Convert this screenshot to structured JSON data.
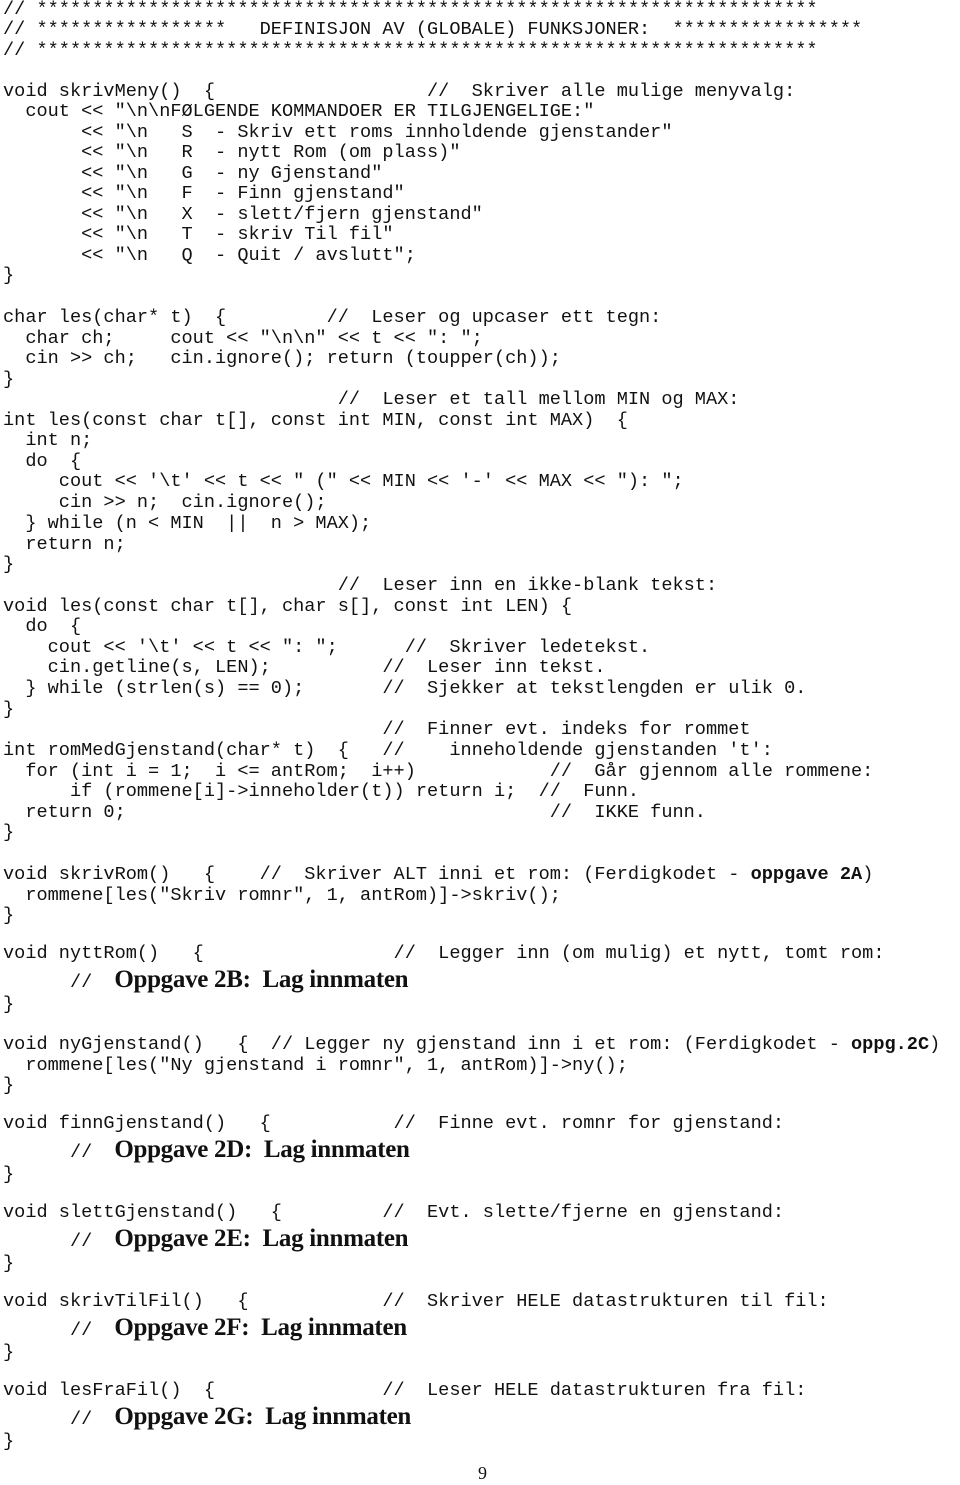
{
  "header": {
    "stars_line": "// **********************************************************************",
    "title_line": "// *****************   DEFINISJON AV (GLOBALE) FUNKSJONER:  *****************"
  },
  "code": {
    "skrivMeny": [
      "void skrivMeny()  {                   //  Skriver alle mulige menyvalg:",
      "  cout << \"\\n\\nFØLGENDE KOMMANDOER ER TILGJENGELIGE:\"",
      "       << \"\\n   S  - Skriv ett roms innholdende gjenstander\"",
      "       << \"\\n   R  - nytt Rom (om plass)\"",
      "       << \"\\n   G  - ny Gjenstand\"",
      "       << \"\\n   F  - Finn gjenstand\"",
      "       << \"\\n   X  - slett/fjern gjenstand\"",
      "       << \"\\n   T  - skriv Til fil\"",
      "       << \"\\n   Q  - Quit / avslutt\";",
      "}"
    ],
    "lesChar": [
      "char les(char* t)  {         //  Leser og upcaser ett tegn:",
      "  char ch;     cout << \"\\n\\n\" << t << \": \";",
      "  cin >> ch;   cin.ignore(); return (toupper(ch));",
      "}"
    ],
    "lesInt": [
      "                              //  Leser et tall mellom MIN og MAX:",
      "int les(const char t[], const int MIN, const int MAX)  {",
      "  int n;",
      "  do  {",
      "     cout << '\\t' << t << \" (\" << MIN << '-' << MAX << \"): \";",
      "     cin >> n;  cin.ignore();",
      "  } while (n < MIN  ||  n > MAX);",
      "  return n;",
      "}"
    ],
    "lesText": [
      "                              //  Leser inn en ikke-blank tekst:",
      "void les(const char t[], char s[], const int LEN) {",
      "  do  {",
      "    cout << '\\t' << t << \": \";      //  Skriver ledetekst.",
      "    cin.getline(s, LEN);          //  Leser inn tekst.",
      "  } while (strlen(s) == 0);       //  Sjekker at tekstlengden er ulik 0.",
      "}"
    ],
    "romMedGjenstand": [
      "                                  //  Finner evt. indeks for rommet",
      "int romMedGjenstand(char* t)  {   //    inneholdende gjenstanden 't':",
      "  for (int i = 1;  i <= antRom;  i++)            //  Går gjennom alle rommene:",
      "      if (rommene[i]->inneholder(t)) return i;  //  Funn.",
      "  return 0;                                      //  IKKE funn.",
      "}"
    ],
    "skrivRom": {
      "head": "void skrivRom()   {    //  Skriver ALT inni et rom: (Ferdigkodet - ",
      "head_bold": "oppgave 2A",
      "head_tail": ")",
      "body": "  rommene[les(\"Skriv romnr\", 1, antRom)]->skriv();",
      "close": "}"
    },
    "nyttRom": {
      "head": "void nyttRom()   {                 //  Legger inn (om mulig) et nytt, tomt rom:",
      "task_slashes": "//",
      "task": "Oppgave 2B:  Lag innmaten",
      "close": "}"
    },
    "nyGjenstand": {
      "head": "void nyGjenstand()   {  // Legger ny gjenstand inn i et rom: (Ferdigkodet - ",
      "head_bold": "oppg.2C",
      "head_tail": ")",
      "body": "  rommene[les(\"Ny gjenstand i romnr\", 1, antRom)]->ny();",
      "close": "}"
    },
    "finnGjenstand": {
      "head": "void finnGjenstand()   {           //  Finne evt. romnr for gjenstand:",
      "task_slashes": "//",
      "task": "Oppgave 2D:  Lag innmaten",
      "close": "}"
    },
    "slettGjenstand": {
      "head": "void slettGjenstand()   {         //  Evt. slette/fjerne en gjenstand:",
      "task_slashes": "//",
      "task": "Oppgave 2E:  Lag innmaten",
      "close": "}"
    },
    "skrivTilFil": {
      "head": "void skrivTilFil()   {            //  Skriver HELE datastrukturen til fil:",
      "task_slashes": "//",
      "task": "Oppgave 2F:  Lag innmaten",
      "close": "}"
    },
    "lesFraFil": {
      "head": "void lesFraFil()  {               //  Leser HELE datastrukturen fra fil:",
      "task_slashes": "//",
      "task": "Oppgave 2G:  Lag innmaten",
      "close": "}"
    }
  },
  "footer": {
    "page_number": "9"
  }
}
